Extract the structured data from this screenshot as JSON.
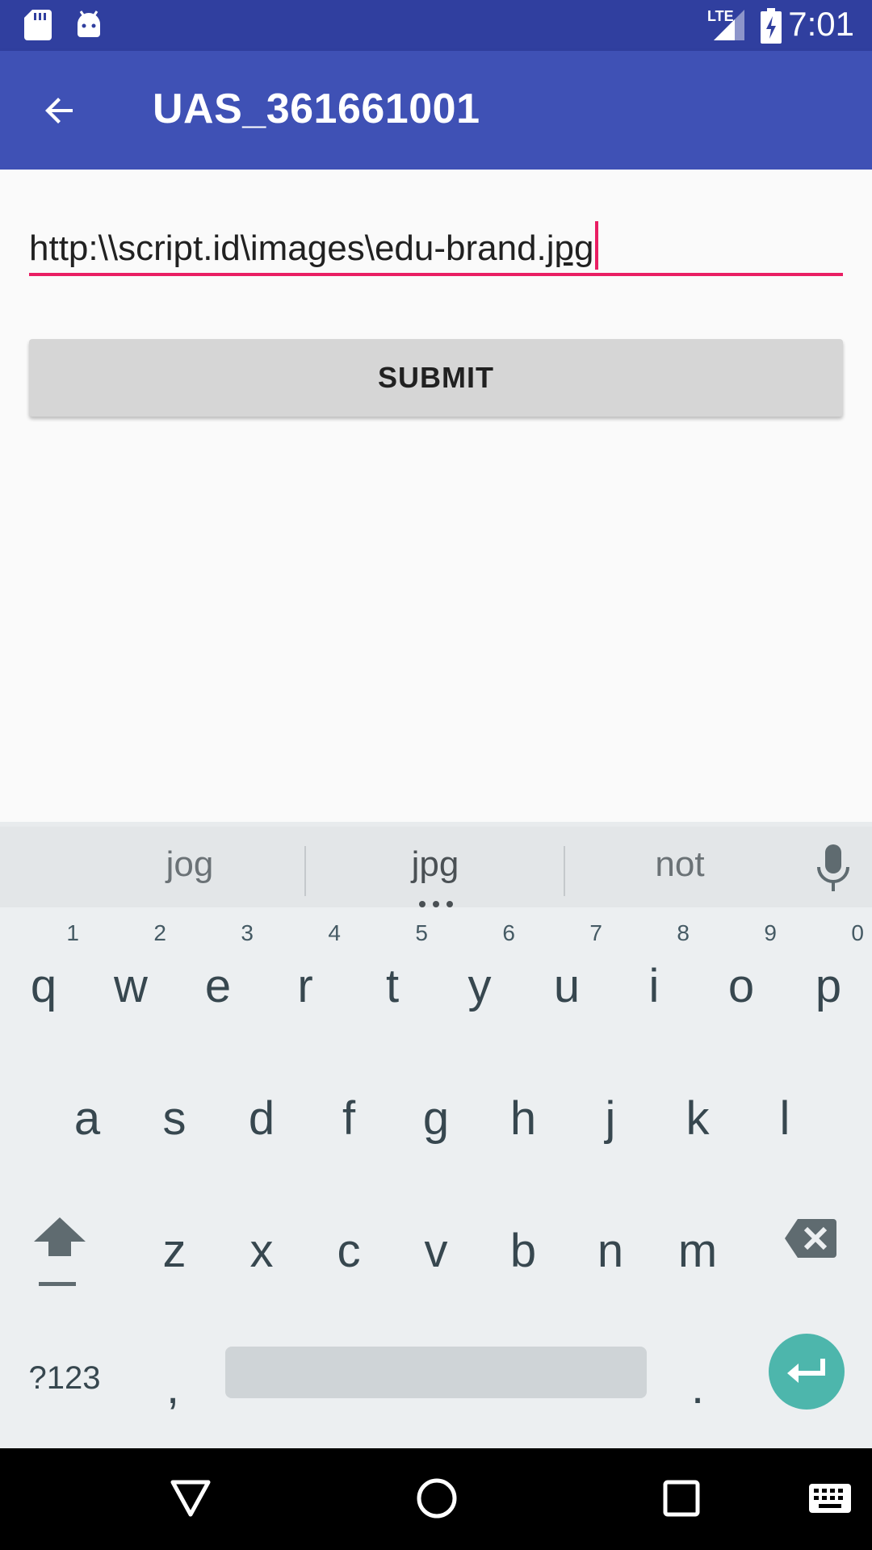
{
  "status_bar": {
    "time": "7:01",
    "network_label": "LTE"
  },
  "app_bar": {
    "title": "UAS_361661001"
  },
  "form": {
    "url_prefix": "http:\\\\script.id\\images\\edu-brand.",
    "url_composing": "jpg",
    "submit_label": "SUBMIT"
  },
  "keyboard": {
    "suggestions": [
      "jog",
      "jpg",
      "not"
    ],
    "row1": [
      {
        "k": "q",
        "h": "1"
      },
      {
        "k": "w",
        "h": "2"
      },
      {
        "k": "e",
        "h": "3"
      },
      {
        "k": "r",
        "h": "4"
      },
      {
        "k": "t",
        "h": "5"
      },
      {
        "k": "y",
        "h": "6"
      },
      {
        "k": "u",
        "h": "7"
      },
      {
        "k": "i",
        "h": "8"
      },
      {
        "k": "o",
        "h": "9"
      },
      {
        "k": "p",
        "h": "0"
      }
    ],
    "row2": [
      "a",
      "s",
      "d",
      "f",
      "g",
      "h",
      "j",
      "k",
      "l"
    ],
    "row3": [
      "z",
      "x",
      "c",
      "v",
      "b",
      "n",
      "m"
    ],
    "symbols_label": "?123",
    "comma": ",",
    "period": "."
  },
  "colors": {
    "status": "#303f9f",
    "appbar": "#3f51b5",
    "accent": "#e91e63",
    "enter": "#4db6ac"
  }
}
